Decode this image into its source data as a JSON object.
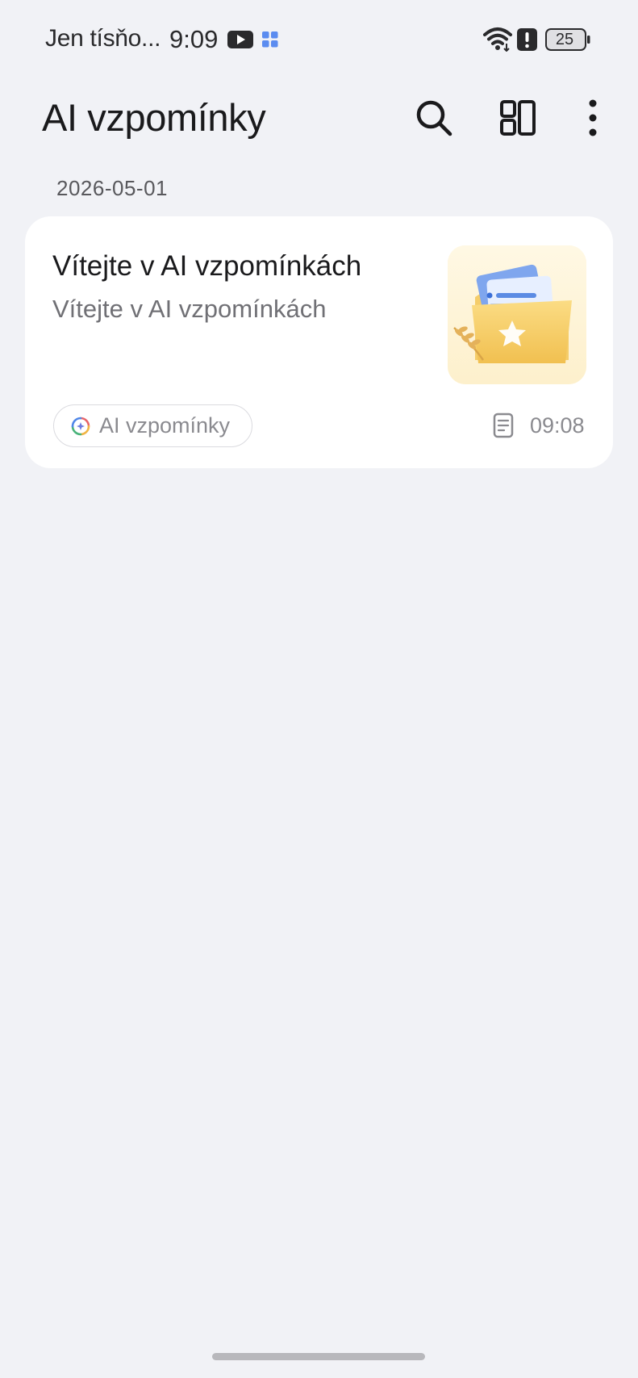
{
  "status_bar": {
    "carrier": "Jen tísňo...",
    "time": "9:09",
    "battery": "25",
    "icons": [
      "youtube-icon",
      "app-grid-icon",
      "wifi-icon",
      "alert-icon",
      "battery-icon"
    ]
  },
  "header": {
    "title": "AI vzpomínky",
    "actions": [
      "search-icon",
      "layout-icon",
      "more-vert-icon"
    ]
  },
  "groups": [
    {
      "date": "2026-05-01",
      "cards": [
        {
          "title": "Vítejte v AI vzpomínkách",
          "subtitle": "Vítejte v AI vzpomínkách",
          "tag": "AI vzpomínky",
          "time": "09:08",
          "thumbnail": "folder-star-illustration"
        }
      ]
    }
  ],
  "colors": {
    "background": "#f1f2f6",
    "card": "#ffffff",
    "text_primary": "#1a1a1c",
    "text_secondary": "#707075",
    "text_tertiary": "#8a8a8f",
    "thumb_bg": "#fdf4d9"
  }
}
